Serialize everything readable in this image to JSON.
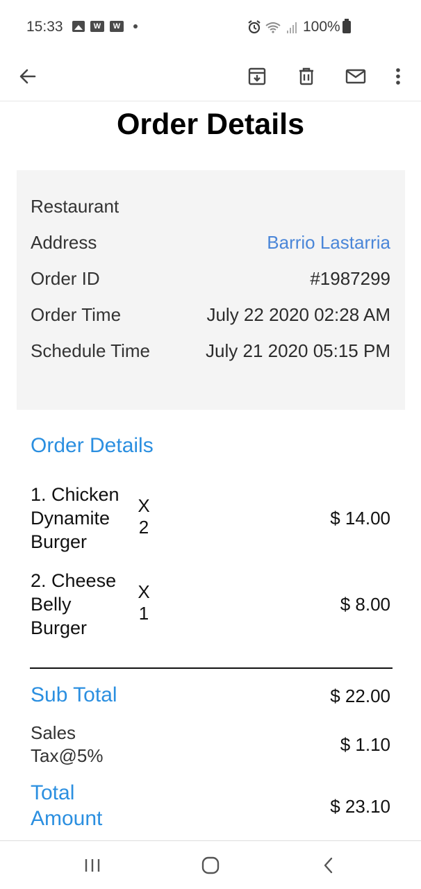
{
  "status_bar": {
    "time": "15:33",
    "battery": "100%",
    "notification_icons": [
      "gallery-icon",
      "w-app-icon",
      "w-app-icon"
    ],
    "system_icons": [
      "alarm-icon",
      "wifi-icon",
      "signal-icon",
      "battery-icon"
    ],
    "w_label": "W"
  },
  "toolbar": {
    "icons": [
      "back-arrow-icon",
      "archive-icon",
      "delete-icon",
      "mail-icon",
      "more-vert-icon"
    ]
  },
  "page": {
    "title": "Order Details"
  },
  "info": {
    "restaurant_label": "Restaurant",
    "restaurant_value": "",
    "address_label": "Address",
    "address_value": "Barrio Lastarria",
    "order_id_label": "Order ID",
    "order_id_value": "#1987299",
    "order_time_label": "Order Time",
    "order_time_value": "July 22 2020 02:28 AM",
    "schedule_time_label": "Schedule Time",
    "schedule_time_value": "July 21 2020 05:15 PM"
  },
  "order": {
    "section_title": "Order Details",
    "items": [
      {
        "name": "1. Chicken Dynamite Burger",
        "qty_prefix": "X",
        "qty": "2",
        "price": "$ 14.00"
      },
      {
        "name": "2. Cheese Belly Burger",
        "qty_prefix": "X",
        "qty": "1",
        "price": "$ 8.00"
      }
    ]
  },
  "summary": {
    "sub_total_label": "Sub Total",
    "sub_total_value": "$ 22.00",
    "tax_label": "Sales Tax@5%",
    "tax_value": "$ 1.10",
    "total_label": "Total Amount",
    "total_value": "$ 23.10"
  },
  "colors": {
    "accent": "#2b8fe0",
    "link": "#4a86d8",
    "info_bg": "#f4f4f4"
  },
  "nav_bar": {
    "icons": [
      "recents-icon",
      "home-icon",
      "back-icon"
    ]
  }
}
